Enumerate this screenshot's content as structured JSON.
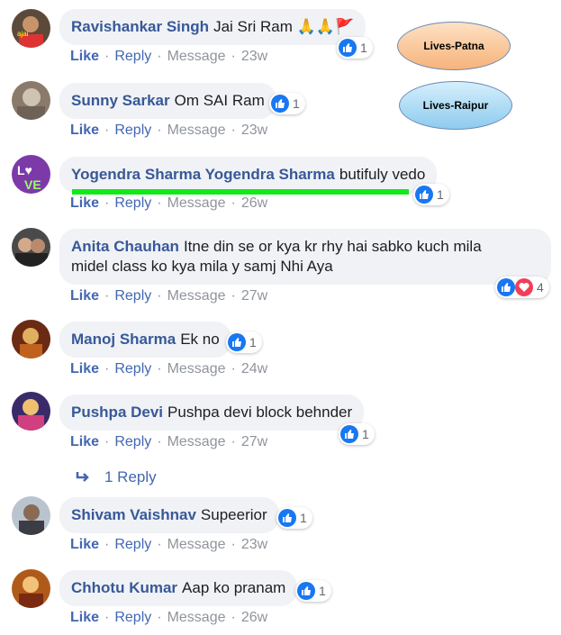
{
  "labels": {
    "like": "Like",
    "reply": "Reply",
    "message": "Message"
  },
  "annotations": {
    "oval1": "Lives-Patna",
    "oval2": "Lives-Raipur"
  },
  "comments": [
    {
      "author": "Ravishankar Singh",
      "text": "Jai Sri Ram 🙏🙏🚩",
      "time": "23w",
      "reactions": "1"
    },
    {
      "author": "Sunny Sarkar",
      "text": "Om SAI Ram",
      "time": "23w",
      "reactions": "1"
    },
    {
      "author": "Yogendra Sharma Yogendra Sharma",
      "text": "butifuly vedo",
      "time": "26w",
      "reactions": "1"
    },
    {
      "author": "Anita Chauhan",
      "text": "Itne din se or kya kr rhy hai sabko kuch mila",
      "text2": "midel class ko kya mila y samj Nhi Aya",
      "time": "27w",
      "reactions": "4"
    },
    {
      "author": "Manoj Sharma",
      "text": "Ek no",
      "time": "24w",
      "reactions": "1"
    },
    {
      "author": "Pushpa Devi",
      "text": "Pushpa devi block behnder",
      "time": "27w",
      "reactions": "1"
    },
    {
      "author": "Shivam Vaishnav",
      "text": "Supeerior",
      "time": "23w",
      "reactions": "1"
    },
    {
      "author": "Chhotu Kumar",
      "text": "Aap ko pranam",
      "time": "26w",
      "reactions": "1"
    }
  ],
  "replies_link": "1 Reply",
  "colors": {
    "link": "#385898",
    "like_blue": "#1877f2",
    "bubble": "#f0f2f5",
    "oval_patna": "#f9c08e",
    "oval_raipur": "#9fd6f3",
    "highlight": "#13e81a"
  },
  "icons": [
    "like-icon",
    "love-icon",
    "reply-arrow-icon"
  ]
}
